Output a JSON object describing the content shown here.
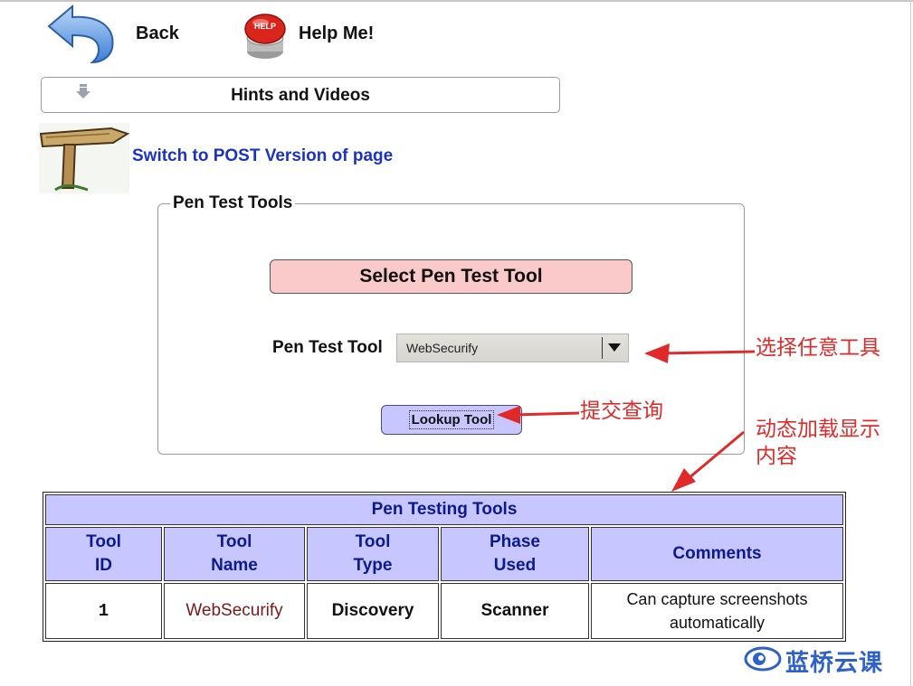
{
  "nav": {
    "back_label": "Back",
    "help_label": "Help Me!",
    "help_badge": "HELP"
  },
  "hints": {
    "label": "Hints and Videos"
  },
  "post_link": {
    "label": "Switch to POST Version of page"
  },
  "form": {
    "legend": "Pen Test Tools",
    "title": "Select Pen Test Tool",
    "tool_label": "Pen Test Tool",
    "tool_selected": "WebSecurify",
    "lookup_button": "Lookup Tool"
  },
  "annotations": {
    "select_any_tool": "选择任意工具",
    "submit_query": "提交查询",
    "dynamic_load_line1": "动态加载显示",
    "dynamic_load_line2": "内容",
    "color": "#e02a2a"
  },
  "results": {
    "caption": "Pen Testing Tools",
    "headers": [
      {
        "line1": "Tool",
        "line2": "ID"
      },
      {
        "line1": "Tool",
        "line2": "Name"
      },
      {
        "line1": "Tool",
        "line2": "Type"
      },
      {
        "line1": "Phase",
        "line2": "Used"
      },
      {
        "line1": "Comments",
        "line2": ""
      }
    ],
    "rows": [
      {
        "id": "1",
        "name": "WebSecurify",
        "type": "Discovery",
        "phase": "Scanner",
        "comment_line1": "Can capture screenshots",
        "comment_line2": "automatically"
      }
    ]
  },
  "watermark": {
    "text": "蓝桥云课"
  },
  "colors": {
    "header_bg": "#c7c6ff",
    "header_text": "#0d1a8c",
    "title_bg": "#fac9c9",
    "link": "#1a33c4",
    "tool_name": "#7a1919",
    "brand": "#2f62c9"
  }
}
